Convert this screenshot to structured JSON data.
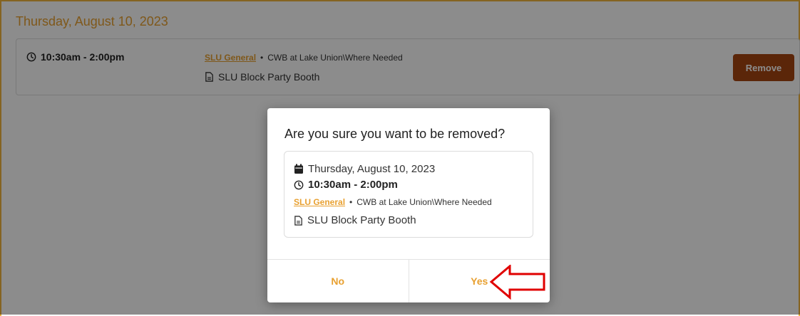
{
  "page": {
    "date_header": "Thursday, August 10, 2023"
  },
  "shift": {
    "time": "10:30am - 2:00pm",
    "organization": "SLU General",
    "separator": "•",
    "location": "CWB at Lake Union\\Where Needed",
    "activity": "SLU Block Party Booth",
    "remove_label": "Remove"
  },
  "dialog": {
    "title": "Are you sure you want to be removed?",
    "date": "Thursday, August 10, 2023",
    "time": "10:30am - 2:00pm",
    "organization": "SLU General",
    "separator": "•",
    "location": "CWB at Lake Union\\Where Needed",
    "activity": "SLU Block Party Booth",
    "no_label": "No",
    "yes_label": "Yes"
  },
  "colors": {
    "accent": "#e8a030",
    "remove_button": "#a64511",
    "annotation_arrow": "#e00000"
  },
  "icons": {
    "clock": "clock-icon",
    "document": "document-icon",
    "calendar": "calendar-icon",
    "annotation": "red-arrow-icon"
  }
}
